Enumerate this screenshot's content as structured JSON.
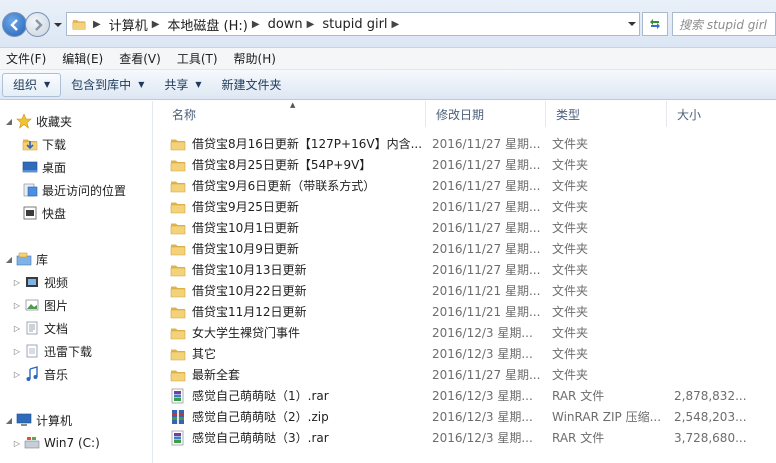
{
  "address": {
    "breadcrumbs": [
      "计算机",
      "本地磁盘 (H:)",
      "down",
      "stupid girl"
    ],
    "search_placeholder": "搜索 stupid girl"
  },
  "menubar": [
    "文件(F)",
    "编辑(E)",
    "查看(V)",
    "工具(T)",
    "帮助(H)"
  ],
  "toolbar": {
    "organize": "组织",
    "include_library": "包含到库中",
    "share": "共享",
    "new_folder": "新建文件夹"
  },
  "sidebar": {
    "favorites": {
      "label": "收藏夹",
      "items": [
        "下载",
        "桌面",
        "最近访问的位置",
        "快盘"
      ]
    },
    "libraries": {
      "label": "库",
      "items": [
        "视频",
        "图片",
        "文档",
        "迅雷下载",
        "音乐"
      ]
    },
    "computer": {
      "label": "计算机",
      "items": [
        "Win7 (C:)"
      ]
    }
  },
  "columns": {
    "name": "名称",
    "date": "修改日期",
    "type": "类型",
    "size": "大小"
  },
  "files": [
    {
      "name": "借贷宝8月16日更新【127P+16V】内含...",
      "date": "2016/11/27 星期...",
      "type": "文件夹",
      "size": "",
      "icon": "folder"
    },
    {
      "name": "借贷宝8月25日更新【54P+9V】",
      "date": "2016/11/27 星期...",
      "type": "文件夹",
      "size": "",
      "icon": "folder"
    },
    {
      "name": "借贷宝9月6日更新（带联系方式）",
      "date": "2016/11/27 星期...",
      "type": "文件夹",
      "size": "",
      "icon": "folder"
    },
    {
      "name": "借贷宝9月25日更新",
      "date": "2016/11/27 星期...",
      "type": "文件夹",
      "size": "",
      "icon": "folder"
    },
    {
      "name": "借贷宝10月1日更新",
      "date": "2016/11/27 星期...",
      "type": "文件夹",
      "size": "",
      "icon": "folder"
    },
    {
      "name": "借贷宝10月9日更新",
      "date": "2016/11/27 星期...",
      "type": "文件夹",
      "size": "",
      "icon": "folder"
    },
    {
      "name": "借贷宝10月13日更新",
      "date": "2016/11/27 星期...",
      "type": "文件夹",
      "size": "",
      "icon": "folder"
    },
    {
      "name": "借贷宝10月22日更新",
      "date": "2016/11/21 星期...",
      "type": "文件夹",
      "size": "",
      "icon": "folder"
    },
    {
      "name": "借贷宝11月12日更新",
      "date": "2016/11/21 星期...",
      "type": "文件夹",
      "size": "",
      "icon": "folder"
    },
    {
      "name": "女大学生裸贷门事件",
      "date": "2016/12/3 星期...",
      "type": "文件夹",
      "size": "",
      "icon": "folder"
    },
    {
      "name": "其它",
      "date": "2016/12/3 星期...",
      "type": "文件夹",
      "size": "",
      "icon": "folder"
    },
    {
      "name": "最新全套",
      "date": "2016/11/27 星期...",
      "type": "文件夹",
      "size": "",
      "icon": "folder"
    },
    {
      "name": "感觉自己萌萌哒（1）.rar",
      "date": "2016/12/3 星期...",
      "type": "RAR 文件",
      "size": "2,878,832...",
      "icon": "rar"
    },
    {
      "name": "感觉自己萌萌哒（2）.zip",
      "date": "2016/12/3 星期...",
      "type": "WinRAR ZIP 压缩...",
      "size": "2,548,203...",
      "icon": "zip"
    },
    {
      "name": "感觉自己萌萌哒（3）.rar",
      "date": "2016/12/3 星期...",
      "type": "RAR 文件",
      "size": "3,728,680...",
      "icon": "rar"
    }
  ]
}
